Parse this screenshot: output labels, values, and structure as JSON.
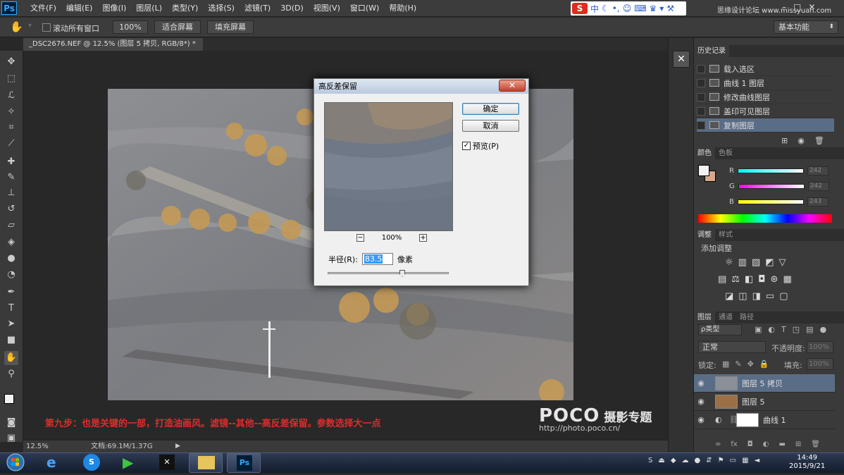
{
  "app": {
    "logo": "Ps"
  },
  "menu": [
    "文件(F)",
    "编辑(E)",
    "图像(I)",
    "图层(L)",
    "类型(Y)",
    "选择(S)",
    "滤镜(T)",
    "3D(D)",
    "视图(V)",
    "窗口(W)",
    "帮助(H)"
  ],
  "ime": {
    "logo": "S",
    "mode": "中"
  },
  "watermark_top": "思缘设计论坛 www.missyuan.com",
  "window_controls": [
    "–",
    "□",
    "✕"
  ],
  "options": {
    "scroll_all": "滚动所有窗口",
    "zoom100": "100%",
    "fit_screen": "适合屏幕",
    "fill_screen": "填充屏幕",
    "workspace": "基本功能"
  },
  "document_tab": "_DSC2676.NEF @ 12.5% (图层 5 拷贝, RGB/8*) *",
  "dialog": {
    "title": "高反差保留",
    "close": "✕",
    "ok": "确定",
    "cancel": "取消",
    "preview_label": "预览(P)",
    "preview_checked": "✓",
    "zoom_minus": "−",
    "zoom_value": "100%",
    "zoom_plus": "+",
    "radius_label": "半径(R):",
    "radius_value": "83.5",
    "radius_unit": "像素"
  },
  "caption": "第九步：也是关键的一部，打造油画风。滤镜--其他--高反差保留。参数选择大一点",
  "poco": {
    "logo": "POCO",
    "zh": "摄影专题",
    "url": "http://photo.poco.cn/"
  },
  "status": {
    "zoom": "12.5%",
    "doc": "文档:69.1M/1.37G"
  },
  "history": {
    "tab": "历史记录",
    "items": [
      "载入选区",
      "曲线 1 图层",
      "修改曲线图层",
      "盖印可见图层",
      "复制图层"
    ]
  },
  "color_panel": {
    "tabs": [
      "颜色",
      "色板"
    ],
    "rows": [
      {
        "label": "R",
        "value": "242"
      },
      {
        "label": "G",
        "value": "242"
      },
      {
        "label": "B",
        "value": "243"
      }
    ]
  },
  "adjust_panel": {
    "tabs": [
      "调整",
      "样式"
    ],
    "title": "添加调整"
  },
  "layers_panel": {
    "tabs": [
      "图层",
      "通道",
      "路径"
    ],
    "filter": "ρ类型",
    "blend": "正常",
    "opacity_label": "不透明度:",
    "opacity_value": "100%",
    "lock_label": "锁定:",
    "fill_label": "填充:",
    "fill_value": "100%",
    "layers": [
      "图层 5 拷贝",
      "图层 5",
      "曲线 1"
    ]
  },
  "clock": {
    "time": "14:49",
    "date": "2015/9/21"
  },
  "colors": {
    "accent_red": "#e12c2c",
    "selection": "#5a6d87"
  }
}
